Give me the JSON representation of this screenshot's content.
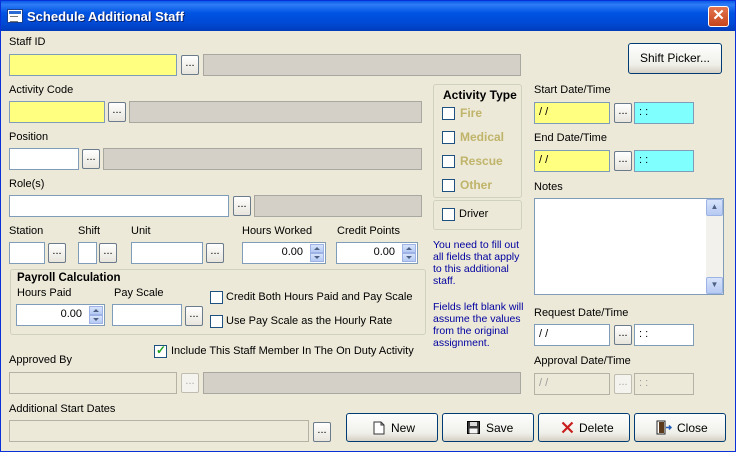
{
  "window": {
    "title": "Schedule Additional Staff"
  },
  "staff_id": {
    "label": "Staff ID",
    "value": "",
    "ellipsis": "..."
  },
  "shift_picker": {
    "label": "Shift Picker..."
  },
  "activity_code": {
    "label": "Activity Code",
    "value": "",
    "ellipsis": "..."
  },
  "position": {
    "label": "Position",
    "value": "",
    "ellipsis": "..."
  },
  "roles": {
    "label": "Role(s)",
    "value": "",
    "ellipsis": "..."
  },
  "station": {
    "label": "Station",
    "ellipsis": "..."
  },
  "shift": {
    "label": "Shift",
    "ellipsis": "..."
  },
  "unit": {
    "label": "Unit",
    "ellipsis": "..."
  },
  "hours_worked": {
    "label": "Hours Worked",
    "value": "0.00"
  },
  "credit_points": {
    "label": "Credit Points",
    "value": "0.00"
  },
  "payroll": {
    "title": "Payroll Calculation",
    "hours_paid_label": "Hours Paid",
    "hours_paid_value": "0.00",
    "pay_scale_label": "Pay Scale",
    "ellipsis": "...",
    "credit_both_label": "Credit Both Hours Paid and Pay Scale",
    "credit_both_checked": false,
    "use_pay_scale_label": "Use Pay Scale as the Hourly Rate",
    "use_pay_scale_checked": false
  },
  "activity_type": {
    "title": "Activity Type",
    "options": [
      {
        "label": "Fire",
        "checked": false
      },
      {
        "label": "Medical",
        "checked": false
      },
      {
        "label": "Rescue",
        "checked": false
      },
      {
        "label": "Other",
        "checked": false
      }
    ],
    "driver_label": "Driver",
    "driver_checked": false
  },
  "help_text": {
    "line1": "You need to fill out all fields that apply to this additional staff.",
    "line2": "Fields left blank will assume the values from the original assignment."
  },
  "include_on_duty": {
    "label": "Include This Staff Member In The On Duty Activity",
    "checked": true
  },
  "approved_by": {
    "label": "Approved By",
    "ellipsis": "..."
  },
  "additional_start_dates": {
    "label": "Additional Start Dates",
    "ellipsis": "..."
  },
  "start_datetime": {
    "label": "Start Date/Time",
    "date": " /  /",
    "time": " :  :",
    "ellipsis": "..."
  },
  "end_datetime": {
    "label": "End Date/Time",
    "date": " /  /",
    "time": " :  :",
    "ellipsis": "..."
  },
  "notes": {
    "label": "Notes",
    "value": ""
  },
  "request_datetime": {
    "label": "Request Date/Time",
    "date": " /  /",
    "time": " :  :",
    "ellipsis": "..."
  },
  "approval_datetime": {
    "label": "Approval Date/Time",
    "date": " /  /",
    "time": " :  :",
    "ellipsis": "..."
  },
  "actions": {
    "new": "New",
    "save": "Save",
    "delete": "Delete",
    "close": "Close"
  },
  "colors": {
    "required_field": "#ffff80",
    "time_field": "#80ffff",
    "title_bar": "#0054e3",
    "window_bg": "#ece9d8"
  }
}
